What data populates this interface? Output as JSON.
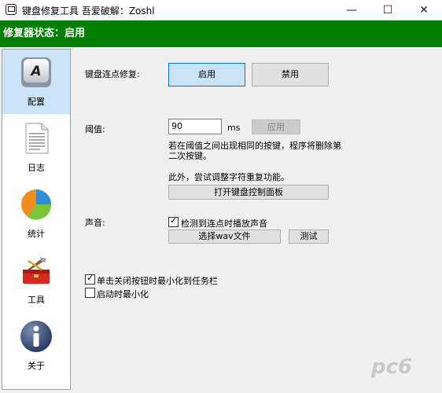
{
  "window": {
    "title": "键盘修复工具 吾爱破解：Zoshl",
    "minimize": "—",
    "maximize": "☐",
    "close": "✕"
  },
  "status": {
    "text": "修复器状态：启用",
    "bg": "#008000"
  },
  "sidebar": {
    "items": [
      {
        "label": "配置",
        "icon": "keyboard-key-icon",
        "active": true
      },
      {
        "label": "日志",
        "icon": "document-icon"
      },
      {
        "label": "统计",
        "icon": "pie-chart-icon"
      },
      {
        "label": "工具",
        "icon": "toolbox-icon"
      },
      {
        "label": "关于",
        "icon": "info-icon"
      }
    ]
  },
  "config": {
    "chatter_label": "键盘连点修复:",
    "enable_btn": "启用",
    "disable_btn": "禁用",
    "threshold_label": "阈值:",
    "threshold_value": "90",
    "threshold_unit": "ms",
    "apply_btn": "应用",
    "threshold_desc_line1": "若在阈值之间出现相同的按键，程序将删除第",
    "threshold_desc_line2": "二次按键。",
    "repeat_hint": "此外，尝试调整字符重复功能。",
    "open_panel_btn": "打开键盘控制面板",
    "sound_label": "声音:",
    "sound_checkbox": "检测到连点时播放声音",
    "choose_wav_btn": "选择wav文件",
    "test_btn": "测试",
    "minimize_on_close": "单击关闭按钮时最小化到任务栏",
    "start_minimized": "启动时最小化"
  },
  "watermark": {
    "text": "pc6"
  }
}
